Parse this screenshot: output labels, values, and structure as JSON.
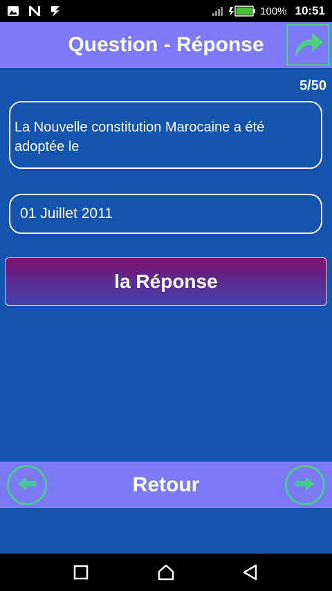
{
  "status_bar": {
    "battery_percent": "100%",
    "time": "10:51",
    "icons": [
      "gallery-icon",
      "n-notification-icon",
      "signal-app-icon",
      "cell-signal-icon",
      "battery-charging-icon"
    ]
  },
  "header": {
    "title": "Question - Réponse",
    "share_icon": "share-forward-icon"
  },
  "counter": "5/50",
  "question": {
    "text": "La Nouvelle constitution Marocaine a été adoptée le"
  },
  "answer": {
    "text": "01 Juillet 2011"
  },
  "reponse_button": {
    "label": "la Réponse"
  },
  "bottom_bar": {
    "label": "Retour",
    "prev_icon": "arrow-left-icon",
    "next_icon": "arrow-right-icon"
  },
  "navigation_bar": {
    "icons": [
      "recents-square-icon",
      "home-icon",
      "back-triangle-icon"
    ]
  },
  "colors": {
    "background": "#1254ae",
    "header": "#7b7bf7",
    "accent_green": "#4ac78c",
    "button_gradient_top": "#7d0f6c",
    "button_gradient_bottom": "#413faa"
  }
}
